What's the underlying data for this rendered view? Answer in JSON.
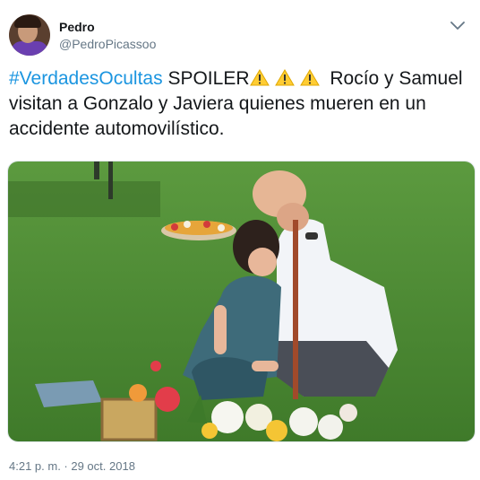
{
  "user": {
    "name": "Pedro",
    "handle": "@PedroPicassoo"
  },
  "tweet": {
    "hashtag": "#VerdadesOcultas",
    "spoiler_word": "SPOILER",
    "body_line1_rest": "Rocío y Samuel",
    "body_continued": "visitan a Gonzalo y Javiera quienes mueren en un accidente automovilístico.",
    "warning_icon": "warning-sign-emoji",
    "warning_count": 3
  },
  "meta": {
    "timestamp": "4:21 p. m. · 29 oct. 2018"
  },
  "colors": {
    "link": "#1b95e0",
    "secondary_text": "#657786",
    "primary_text": "#14171a",
    "grass": "#4f8a35"
  }
}
